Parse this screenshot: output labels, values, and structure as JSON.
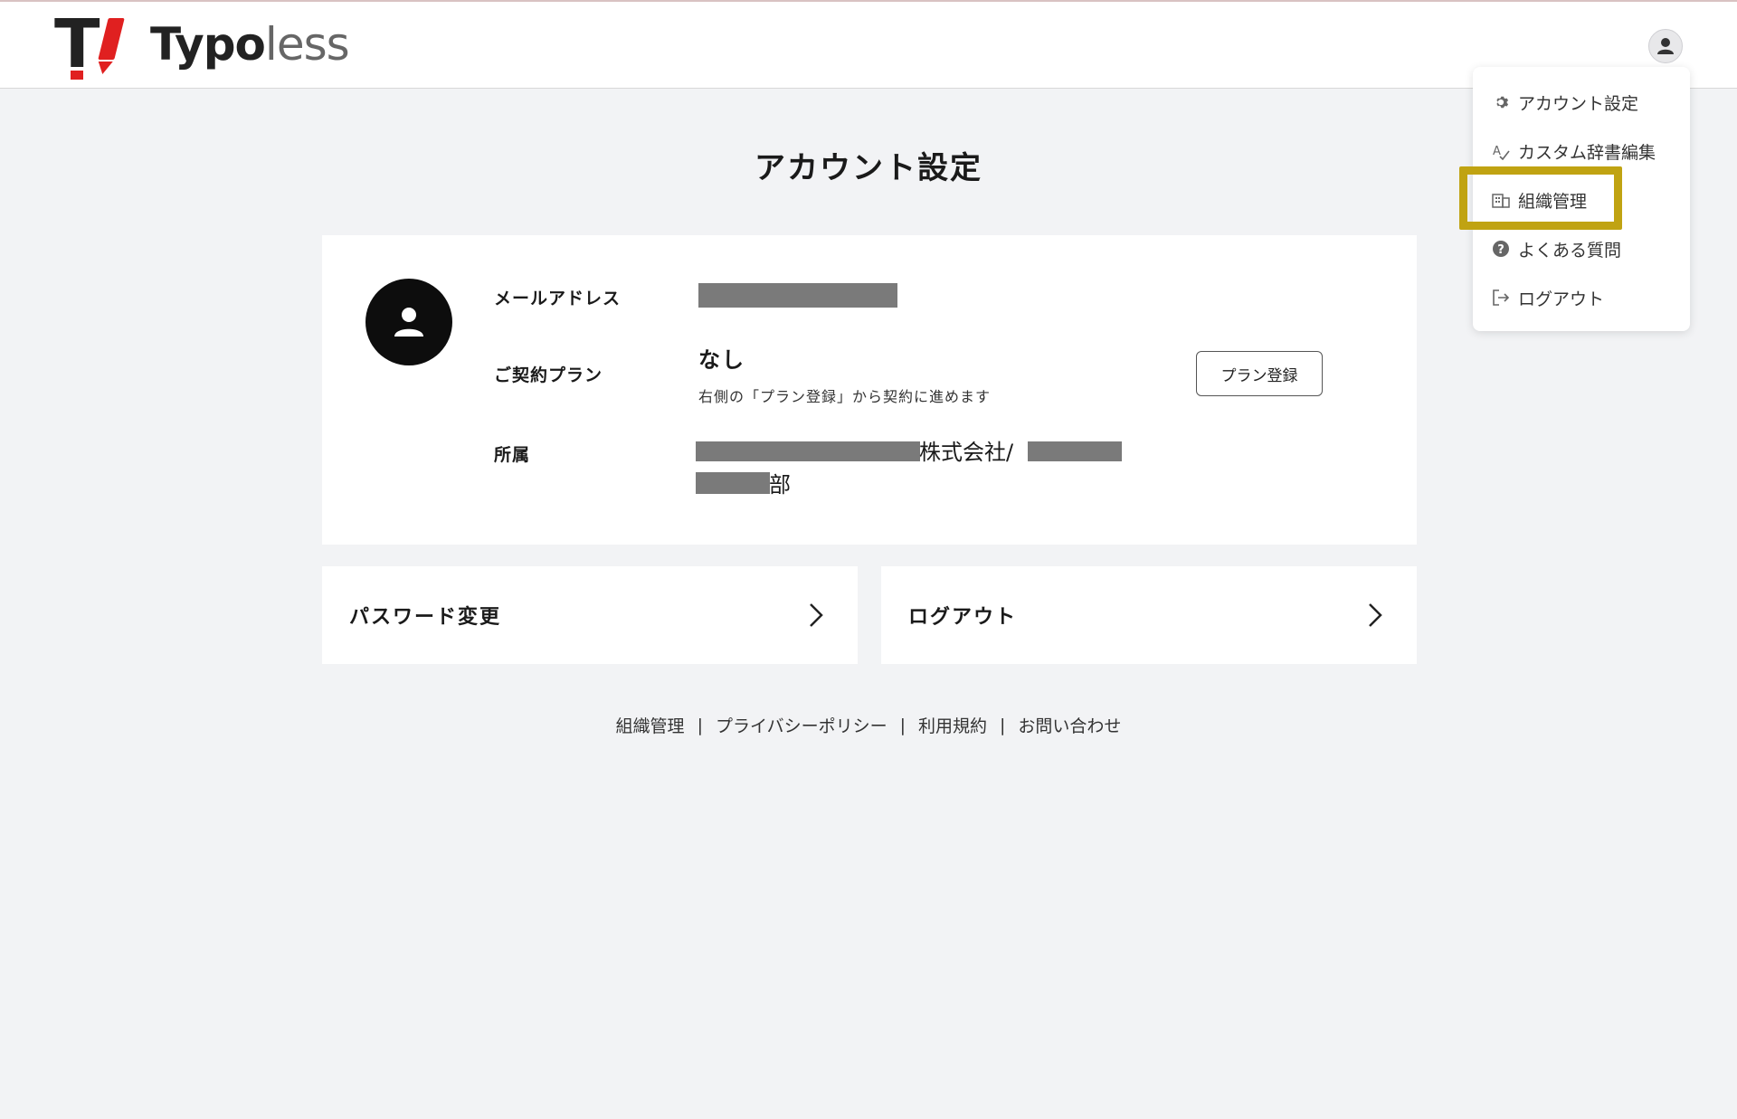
{
  "header": {
    "logo_text_part1": "Typo",
    "logo_text_part2": "less"
  },
  "dropdown": {
    "items": [
      {
        "label": "アカウント設定",
        "icon": "gear-icon"
      },
      {
        "label": "カスタム辞書編集",
        "icon": "dictionary-edit-icon"
      },
      {
        "label": "組織管理",
        "icon": "building-icon"
      },
      {
        "label": "よくある質問",
        "icon": "question-icon"
      },
      {
        "label": "ログアウト",
        "icon": "logout-icon"
      }
    ],
    "highlighted_item": "組織管理"
  },
  "page": {
    "title": "アカウント設定"
  },
  "account": {
    "email_label": "メールアドレス",
    "plan_label": "ご契約プラン",
    "plan_value": "なし",
    "plan_note": "右側の「プラン登録」から契約に進めます",
    "plan_button": "プラン登録",
    "affiliation_label": "所属",
    "affiliation_company_suffix": "株式会社/",
    "affiliation_dept_suffix": "部"
  },
  "nav_cards": {
    "password_label": "パスワード変更",
    "logout_label": "ログアウト"
  },
  "footer": {
    "links": [
      "組織管理",
      "プライバシーポリシー",
      "利用規約",
      "お問い合わせ"
    ],
    "separator": "|"
  },
  "colors": {
    "background": "#f2f3f5",
    "highlight_border": "#c0a312",
    "logo_red": "#e02020",
    "redaction": "#7a7a7a"
  }
}
